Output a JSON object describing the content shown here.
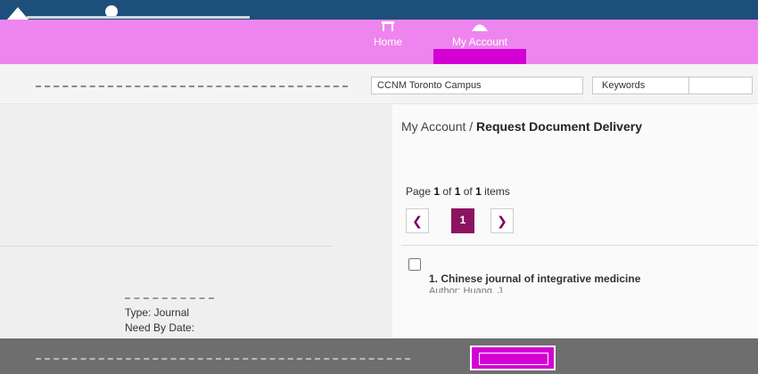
{
  "nav": {
    "home_label": "Home",
    "account_label": "My Account"
  },
  "search": {
    "campus": "CCNM Toronto Campus",
    "field": "Keywords"
  },
  "breadcrumb": {
    "parent": "My Account",
    "separator": " / ",
    "current": "Request Document Delivery"
  },
  "pager": {
    "prefix": "Page ",
    "page": "1",
    "of1": " of ",
    "pages": "1",
    "of2": " of ",
    "items": "1",
    "suffix": " items",
    "current_button": "1"
  },
  "item": {
    "title": "1. Chinese journal of integrative medicine",
    "author": "Author: Huang, J."
  },
  "details": {
    "type": "Type: Journal",
    "need_by": "Need By Date:"
  },
  "colors": {
    "top_bar": "#1c4f7a",
    "nav_band": "#ee85ee",
    "accent": "#d400d4",
    "current_page": "#8b1460"
  }
}
